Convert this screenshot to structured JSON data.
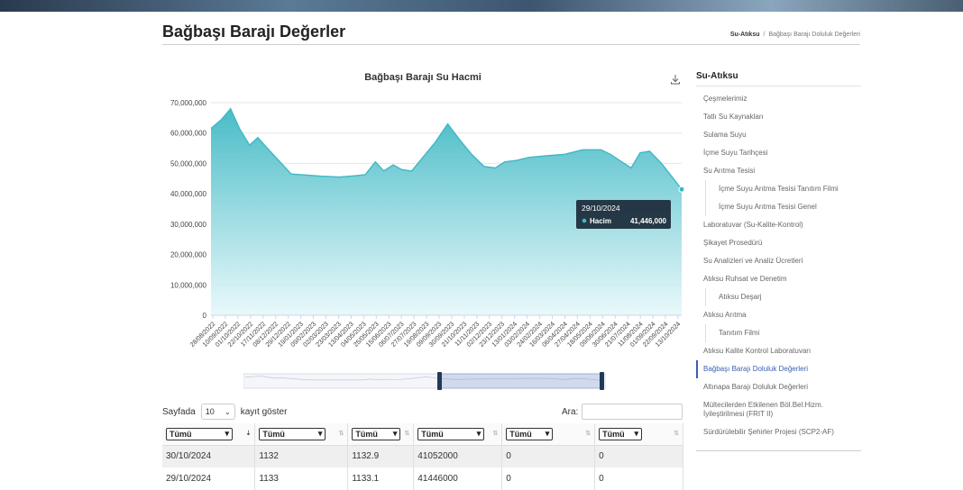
{
  "page": {
    "title": "Bağbaşı Barajı Değerler"
  },
  "breadcrumb": {
    "parent": "Su-Atıksu",
    "separator": "/",
    "current": "Bağbaşı Barajı Doluluk Değerleri"
  },
  "chart_data": {
    "type": "area",
    "title": "Bağbaşı Barajı Su Hacmi",
    "xlabel": "",
    "ylabel": "",
    "ylim": [
      0,
      70000000
    ],
    "yticks": [
      "70,000,000",
      "60,000,000",
      "50,000,000",
      "40,000,000",
      "30,000,000",
      "20,000,000",
      "10,000,000",
      "0"
    ],
    "xtick_labels": [
      "28/08/2022",
      "10/09/2022",
      "01/10/2022",
      "22/10/2022",
      "17/11/2022",
      "08/12/2022",
      "29/12/2022",
      "19/01/2023",
      "09/02/2023",
      "02/03/2023",
      "23/03/2023",
      "13/04/2023",
      "04/05/2023",
      "25/05/2023",
      "15/06/2023",
      "06/07/2023",
      "27/07/2023",
      "19/08/2023",
      "09/09/2023",
      "30/09/2023",
      "21/10/2023",
      "11/11/2023",
      "02/12/2023",
      "23/12/2023",
      "13/01/2024",
      "03/02/2024",
      "24/02/2024",
      "16/03/2024",
      "06/04/2024",
      "27/04/2024",
      "18/05/2024",
      "09/06/2024",
      "30/06/2024",
      "21/07/2024",
      "11/08/2024",
      "01/09/2024",
      "22/09/2024",
      "13/10/2024"
    ],
    "series": [
      {
        "name": "Hacim",
        "x": [
          "28/08/2022",
          "15/09/2022",
          "30/09/2022",
          "15/10/2022",
          "01/11/2022",
          "15/11/2022",
          "01/12/2022",
          "20/12/2022",
          "10/01/2023",
          "01/02/2023",
          "01/03/2023",
          "01/04/2023",
          "01/05/2023",
          "15/05/2023",
          "01/06/2023",
          "15/06/2023",
          "01/07/2023",
          "15/07/2023",
          "01/08/2023",
          "20/08/2023",
          "10/09/2023",
          "01/10/2023",
          "20/10/2023",
          "10/11/2023",
          "01/12/2023",
          "20/12/2023",
          "05/01/2024",
          "25/01/2024",
          "15/02/2024",
          "15/03/2024",
          "15/04/2024",
          "15/05/2024",
          "15/06/2024",
          "01/07/2024",
          "20/07/2024",
          "05/08/2024",
          "20/08/2024",
          "05/09/2024",
          "25/09/2024",
          "15/10/2024",
          "29/10/2024"
        ],
        "values": [
          61500000,
          64500000,
          68000000,
          61500000,
          56000000,
          58500000,
          55000000,
          51000000,
          46500000,
          46200000,
          45800000,
          45500000,
          46000000,
          46300000,
          50500000,
          47500000,
          49500000,
          48000000,
          47500000,
          52000000,
          57000000,
          63000000,
          58000000,
          53000000,
          49000000,
          48500000,
          50500000,
          51000000,
          52000000,
          52500000,
          53000000,
          54500000,
          54500000,
          53000000,
          50500000,
          48500000,
          53500000,
          54000000,
          50000000,
          45000000,
          41446000
        ]
      }
    ],
    "tooltip": {
      "date": "29/10/2024",
      "series_name": "Hacim",
      "value": "41,446,000"
    },
    "color": "#3fb8c4"
  },
  "table": {
    "length_label_before": "Sayfada",
    "length_value": "10",
    "length_label_after": "kayıt göster",
    "search_label": "Ara:",
    "filter_label": "Tümü",
    "rows": [
      [
        "30/10/2024",
        "1132",
        "1132.9",
        "41052000",
        "0",
        "0"
      ],
      [
        "29/10/2024",
        "1133",
        "1133.1",
        "41446000",
        "0",
        "0"
      ]
    ]
  },
  "sidebar": {
    "title": "Su-Atıksu",
    "items": [
      {
        "label": "Çeşmelerimiz",
        "sub": false
      },
      {
        "label": "Tatlı Su Kaynakları",
        "sub": false
      },
      {
        "label": "Sulama Suyu",
        "sub": false
      },
      {
        "label": "İçme Suyu Tarihçesi",
        "sub": false
      },
      {
        "label": "Su Arıtma Tesisi",
        "sub": false
      },
      {
        "label": "İçme Suyu Arıtma Tesisi Tanıtım Filmi",
        "sub": true
      },
      {
        "label": "İçme Suyu Arıtma Tesisi Genel",
        "sub": true
      },
      {
        "label": "Laboratuvar (Su-Kalite-Kontrol)",
        "sub": false
      },
      {
        "label": "Şikayet Prosedürü",
        "sub": false
      },
      {
        "label": "Su Analizleri ve Analiz Ücretleri",
        "sub": false
      },
      {
        "label": "Atıksu Ruhsat ve Denetim",
        "sub": false
      },
      {
        "label": "Atıksu Deşarj",
        "sub": true
      },
      {
        "label": "Atıksu Arıtma",
        "sub": false
      },
      {
        "label": "Tanıtım Filmi",
        "sub": true
      },
      {
        "label": "Atıksu Kalite Kontrol Laboratuvarı",
        "sub": false
      },
      {
        "label": "Bağbaşı Barajı Doluluk Değerleri",
        "sub": false,
        "active": true
      },
      {
        "label": "Altınapa Barajı Doluluk Değerleri",
        "sub": false
      },
      {
        "label": "Mültecilerden Etkilenen Böl.Bel.Hizm. İyileştirilmesi (FRIT II)",
        "sub": false
      },
      {
        "label": "Sürdürülebilir Şehirler Projesi (SCP2-AF)",
        "sub": false
      }
    ]
  }
}
